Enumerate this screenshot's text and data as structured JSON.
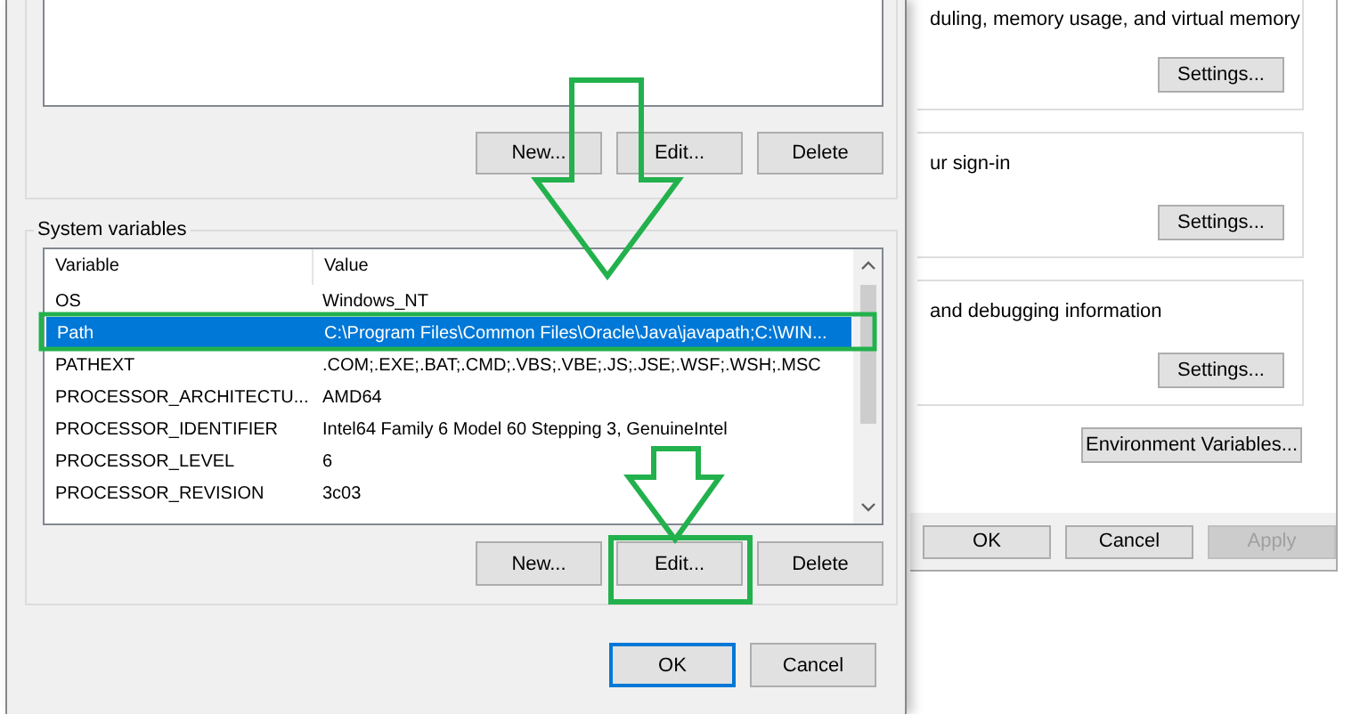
{
  "performance_window": {
    "groups": [
      {
        "text": "duling, memory usage, and virtual memory",
        "button": "Settings..."
      },
      {
        "text": "ur sign-in",
        "button": "Settings..."
      },
      {
        "text": "and debugging information",
        "button": "Settings..."
      }
    ],
    "environment_button": "Environment Variables...",
    "buttons": [
      {
        "label": "OK",
        "disabled": false
      },
      {
        "label": "Cancel",
        "disabled": false
      },
      {
        "label": "Apply",
        "disabled": true
      }
    ]
  },
  "environment_window": {
    "user_variables": {
      "buttons": [
        "New...",
        "Edit...",
        "Delete"
      ]
    },
    "system_variables": {
      "label": "System variables",
      "columns": [
        "Variable",
        "Value"
      ],
      "rows": [
        {
          "variable": "OS",
          "value": "Windows_NT",
          "selected": false
        },
        {
          "variable": "Path",
          "value": "C:\\Program Files\\Common Files\\Oracle\\Java\\javapath;C:\\WIN...",
          "selected": true
        },
        {
          "variable": "PATHEXT",
          "value": ".COM;.EXE;.BAT;.CMD;.VBS;.VBE;.JS;.JSE;.WSF;.WSH;.MSC",
          "selected": false
        },
        {
          "variable": "PROCESSOR_ARCHITECTU...",
          "value": "AMD64",
          "selected": false
        },
        {
          "variable": "PROCESSOR_IDENTIFIER",
          "value": "Intel64 Family 6 Model 60 Stepping 3, GenuineIntel",
          "selected": false
        },
        {
          "variable": "PROCESSOR_LEVEL",
          "value": "6",
          "selected": false
        },
        {
          "variable": "PROCESSOR_REVISION",
          "value": "3c03",
          "selected": false
        }
      ],
      "buttons": [
        "New...",
        "Edit...",
        "Delete"
      ]
    },
    "buttons": [
      {
        "label": "OK",
        "default": true
      },
      {
        "label": "Cancel",
        "default": false
      }
    ]
  }
}
